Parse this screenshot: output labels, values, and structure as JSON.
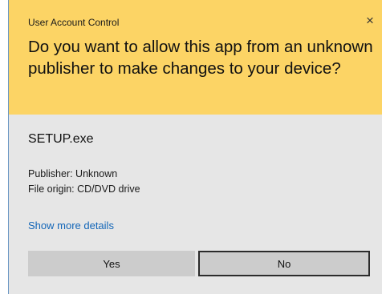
{
  "dialog": {
    "window_title": "User Account Control",
    "close_glyph": "×",
    "question": "Do you want to allow this app from an unknown publisher to make changes to your device?",
    "app_name": "SETUP.exe",
    "publisher": "Publisher: Unknown",
    "file_origin": "File origin: CD/DVD drive",
    "details_link": "Show more details",
    "yes_label": "Yes",
    "no_label": "No"
  },
  "colors": {
    "header_background": "#fcd465",
    "body_background": "#e6e6e6",
    "link": "#1366b8",
    "button": "#cccccc"
  }
}
